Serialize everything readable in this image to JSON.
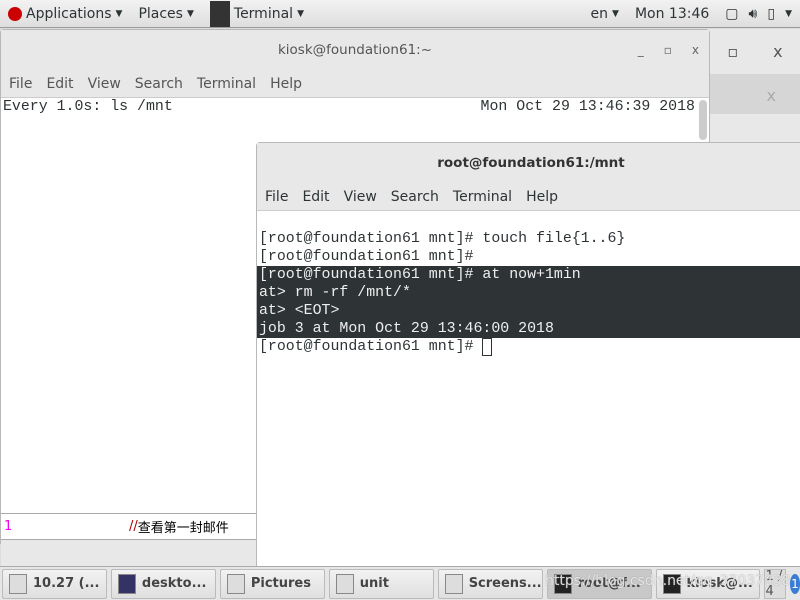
{
  "topbar": {
    "applications": "Applications",
    "places": "Places",
    "terminal": "Terminal",
    "lang": "en",
    "clock": "Mon 13:46"
  },
  "bg_window": {
    "maximize": "▫",
    "close": "x",
    "tab_close": "x"
  },
  "kiosk": {
    "title": "kiosk@foundation61:~",
    "menu": [
      "File",
      "Edit",
      "View",
      "Search",
      "Terminal",
      "Help"
    ],
    "watch_cmd": "Every 1.0s: ls /mnt",
    "watch_time": "Mon Oct 29 13:46:39 2018",
    "editor_line_no": "1",
    "editor_comment": "//",
    "editor_text": "查看第一封邮件",
    "minimize": "_",
    "maximize": "▫",
    "close": "x"
  },
  "root": {
    "title": "root@foundation61:/mnt",
    "menu": [
      "File",
      "Edit",
      "View",
      "Search",
      "Terminal",
      "Help"
    ],
    "lines": [
      "[root@foundation61 mnt]# touch file{1..6}",
      "[root@foundation61 mnt]# "
    ],
    "selected": [
      "[root@foundation61 mnt]# at now+1min",
      "at> rm -rf /mnt/*",
      "at> <EOT>",
      "job 3 at Mon Oct 29 13:46:00 2018"
    ],
    "prompt": "[root@foundation61 mnt]# "
  },
  "taskbar": {
    "items": [
      "10.27 (...",
      "deskto...",
      "Pictures",
      "unit",
      "Screens...",
      "root@f...",
      "kiosk@..."
    ],
    "workspace": "1 / 4",
    "watermark": "https://blog.csdn.net/qq_37037438"
  }
}
